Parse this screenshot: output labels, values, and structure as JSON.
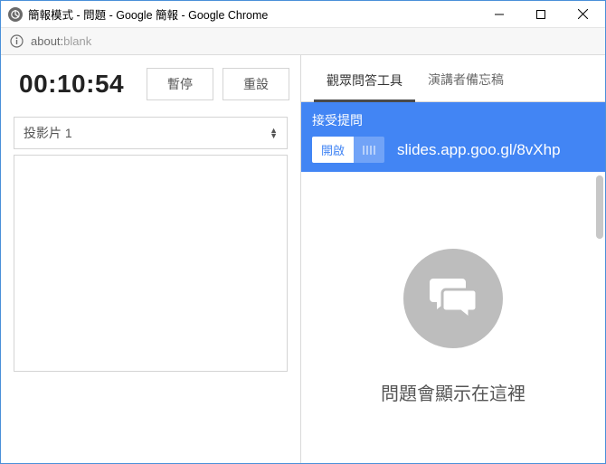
{
  "window": {
    "title": "簡報模式 - 問題 - Google 簡報 - Google Chrome"
  },
  "address": {
    "scheme": "about:",
    "path": "blank"
  },
  "timer": {
    "value": "00:10:54",
    "pause_label": "暫停",
    "reset_label": "重設"
  },
  "slide": {
    "selector_label": "投影片 1"
  },
  "tabs": {
    "qa": "觀眾問答工具",
    "notes": "演講者備忘稿"
  },
  "qa": {
    "accept_label": "接受提問",
    "toggle_on": "開啟",
    "link": "slides.app.goo.gl/8vXhp",
    "empty_text": "問題會顯示在這裡"
  }
}
